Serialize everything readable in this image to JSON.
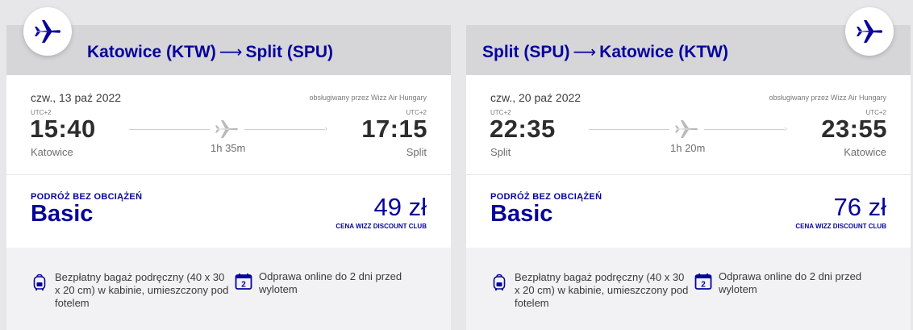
{
  "flights": [
    {
      "route": {
        "from": "Katowice (KTW)",
        "arrow": "⟶",
        "to": "Split (SPU)"
      },
      "date": "czw., 13 paź 2022",
      "operated_by": "obsługiwany przez Wizz Air Hungary",
      "departure": {
        "utc": "UTC+2",
        "time": "15:40",
        "city": "Katowice"
      },
      "arrival": {
        "utc": "UTC+2",
        "time": "17:15",
        "city": "Split"
      },
      "duration": "1h 35m",
      "fare": {
        "eyebrow": "PODRÓŻ BEZ OBCIĄŻEŃ",
        "name": "Basic",
        "price": "49 zł",
        "sub": "CENA WIZZ DISCOUNT CLUB"
      },
      "benefits": {
        "bag": "Bezpłatny bagaż podręczny (40 x 30 x 20 cm) w kabinie, umieszczony pod fotelem",
        "checkin_icon_text": "2",
        "checkin": "Odprawa online do 2 dni przed wylotem"
      }
    },
    {
      "route": {
        "from": "Split (SPU)",
        "arrow": "⟶",
        "to": "Katowice (KTW)"
      },
      "date": "czw., 20 paź 2022",
      "operated_by": "obsługiwany przez Wizz Air Hungary",
      "departure": {
        "utc": "UTC+2",
        "time": "22:35",
        "city": "Split"
      },
      "arrival": {
        "utc": "UTC+2",
        "time": "23:55",
        "city": "Katowice"
      },
      "duration": "1h 20m",
      "fare": {
        "eyebrow": "PODRÓŻ BEZ OBCIĄŻEŃ",
        "name": "Basic",
        "price": "76 zł",
        "sub": "CENA WIZZ DISCOUNT CLUB"
      },
      "benefits": {
        "bag": "Bezpłatny bagaż podręczny (40 x 30 x 20 cm) w kabinie, umieszczony pod fotelem",
        "checkin_icon_text": "2",
        "checkin": "Odprawa online do 2 dni przed wylotem"
      }
    }
  ],
  "icons": {
    "badge": "airplane-icon",
    "timeline": "airplane-icon",
    "bag": "backpack-icon",
    "checkin": "calendar-icon"
  },
  "colors": {
    "brand": "#06049a",
    "header_bg": "#d6d6d9",
    "benefits_bg": "#f2f2f4",
    "page_bg": "#e7e7ea"
  }
}
